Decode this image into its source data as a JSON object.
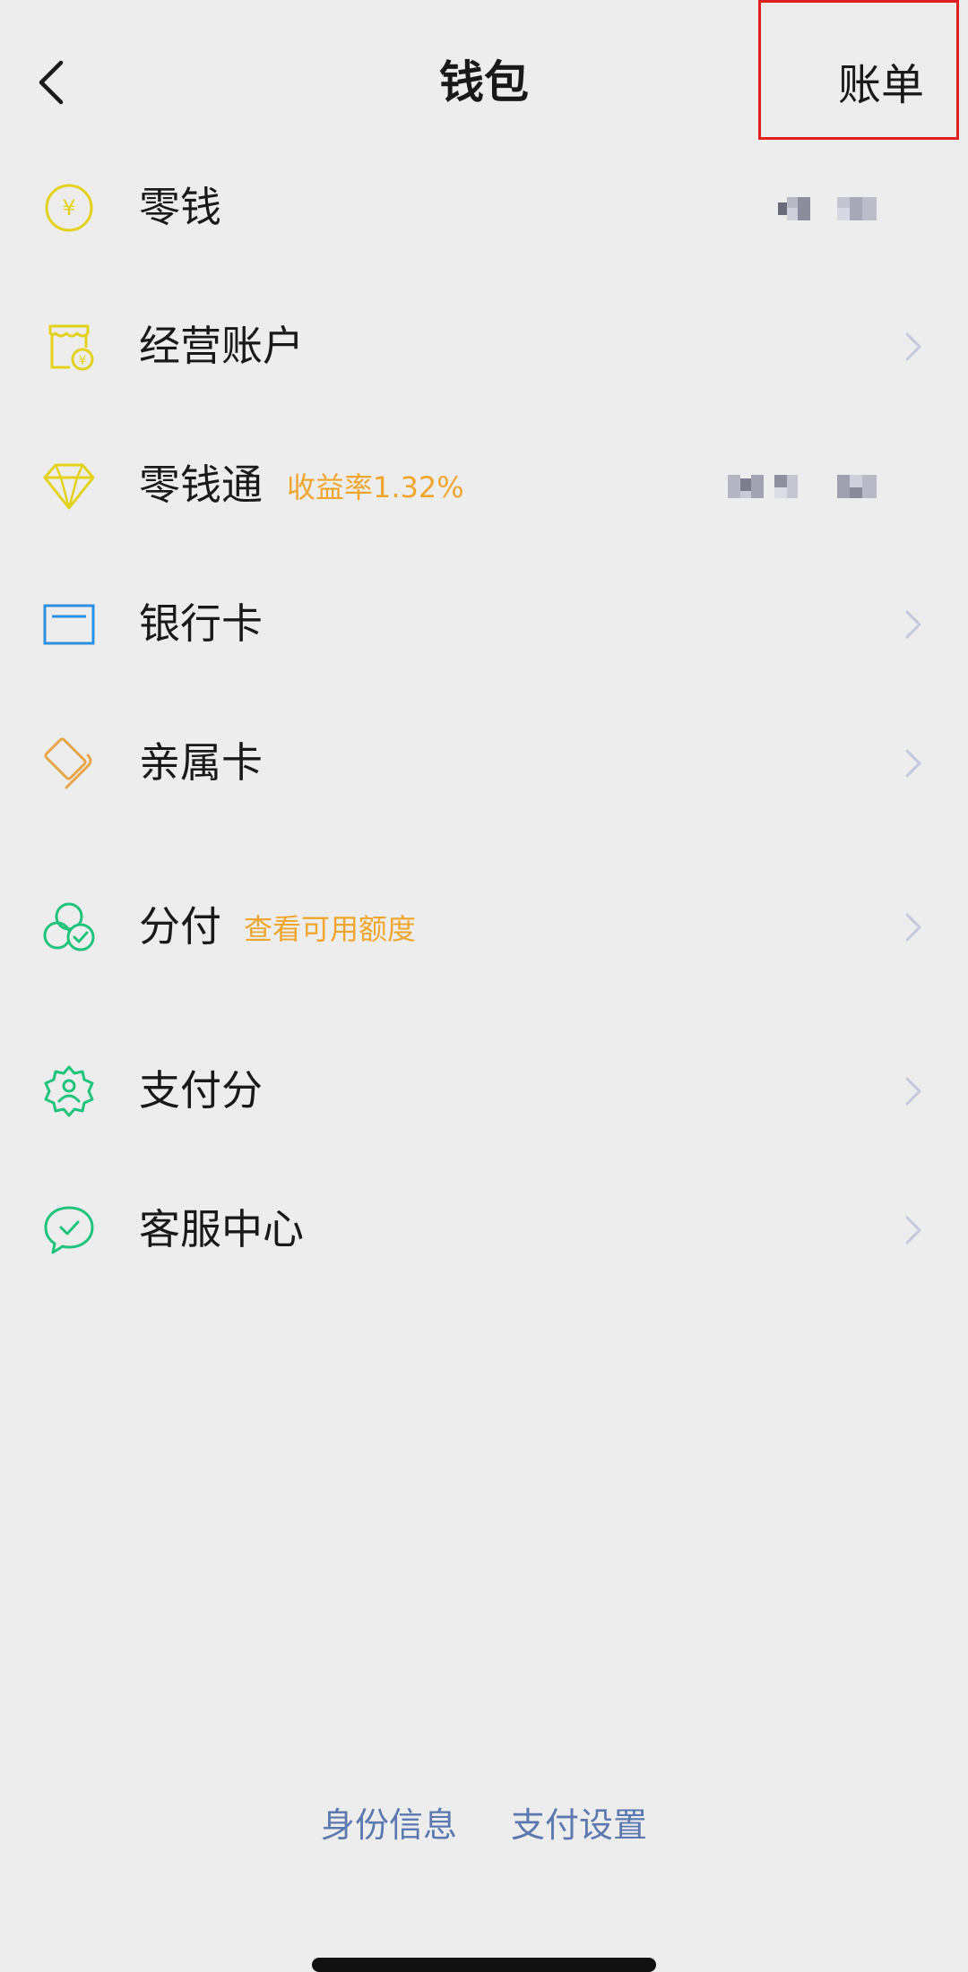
{
  "nav": {
    "title": "钱包",
    "bill_label": "账单"
  },
  "menu": {
    "change": {
      "label": "零钱",
      "icon": "yen-coin-icon",
      "color": "#e3d21c"
    },
    "business": {
      "label": "经营账户",
      "icon": "store-icon",
      "color": "#e3d21c"
    },
    "lingqiantong": {
      "label": "零钱通",
      "tag": "收益率1.32%",
      "icon": "diamond-icon",
      "color": "#e3d21c"
    },
    "bank_card": {
      "label": "银行卡",
      "icon": "bank-card-icon",
      "color": "#2d8fe0"
    },
    "family_card": {
      "label": "亲属卡",
      "icon": "family-card-icon",
      "color": "#e8a64a"
    },
    "fenfu": {
      "label": "分付",
      "tag": "查看可用额度",
      "icon": "fenfu-icon",
      "color": "#1fc37a"
    },
    "pay_score": {
      "label": "支付分",
      "icon": "pay-score-icon",
      "color": "#1fc37a"
    },
    "customer_service": {
      "label": "客服中心",
      "icon": "customer-service-icon",
      "color": "#1fc37a"
    }
  },
  "footer": {
    "identity": "身份信息",
    "pay_settings": "支付设置"
  },
  "colors": {
    "background": "#ededed",
    "tag": "#f0a62e",
    "link": "#5c78b0",
    "highlight": "#e02020"
  }
}
